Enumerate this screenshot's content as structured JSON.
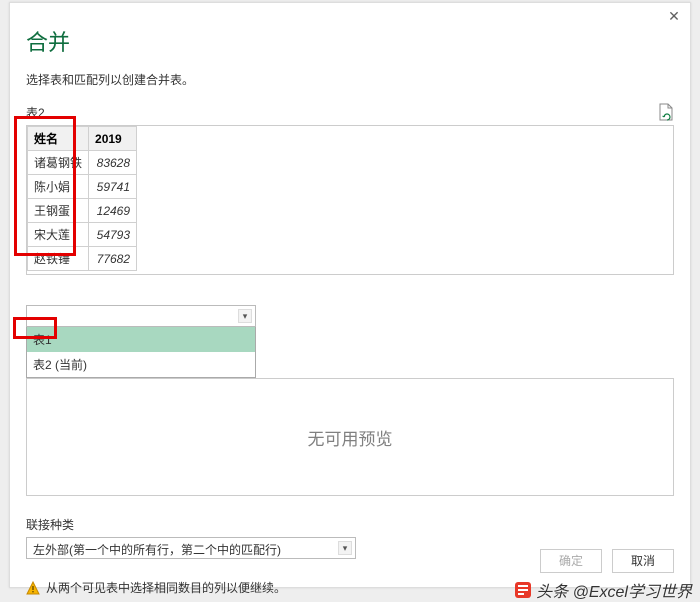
{
  "dialog": {
    "title": "合并",
    "subtitle": "选择表和匹配列以创建合并表。",
    "table2label": "表2"
  },
  "tableData": {
    "headers": [
      "姓名",
      "2019"
    ],
    "rows": [
      [
        "诸葛钢铁",
        "83628"
      ],
      [
        "陈小娟",
        "59741"
      ],
      [
        "王钢蛋",
        "12469"
      ],
      [
        "宋大莲",
        "54793"
      ],
      [
        "赵铁锤",
        "77682"
      ]
    ]
  },
  "dropdown": {
    "items": [
      "表1",
      "表2 (当前)"
    ]
  },
  "previewEmpty": "无可用预览",
  "join": {
    "label": "联接种类",
    "selected": "左外部(第一个中的所有行，第二个中的匹配行)"
  },
  "warning": "从两个可见表中选择相同数目的列以便继续。",
  "buttons": {
    "ok": "确定",
    "cancel": "取消"
  },
  "watermark": "头条 @Excel学习世界"
}
